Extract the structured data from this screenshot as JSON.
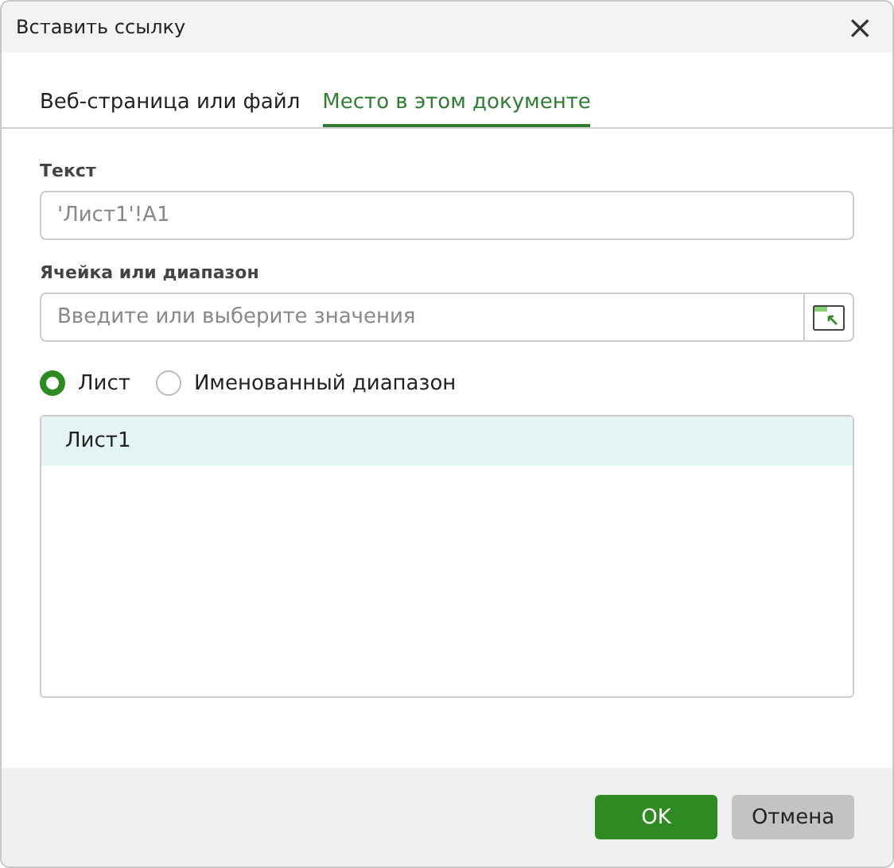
{
  "window": {
    "title": "Вставить ссылку",
    "close": "×"
  },
  "tabs": [
    {
      "label": "Веб-страница или файл",
      "selected": false
    },
    {
      "label": "Место в этом документе",
      "selected": true
    }
  ],
  "text_field": {
    "label": "Текст",
    "value": "'Лист1'!A1"
  },
  "range_field": {
    "label": "Ячейка или диапазон",
    "placeholder": "Введите или выберите значения"
  },
  "radios": [
    {
      "label": "Лист",
      "selected": true
    },
    {
      "label": "Именованный диапазон",
      "selected": false
    }
  ],
  "list": {
    "items": [
      {
        "label": "Лист1",
        "selected": true
      }
    ]
  },
  "buttons": [
    {
      "label": "OK",
      "kind": "primary"
    },
    {
      "label": "Отмена",
      "kind": "secondary"
    }
  ]
}
